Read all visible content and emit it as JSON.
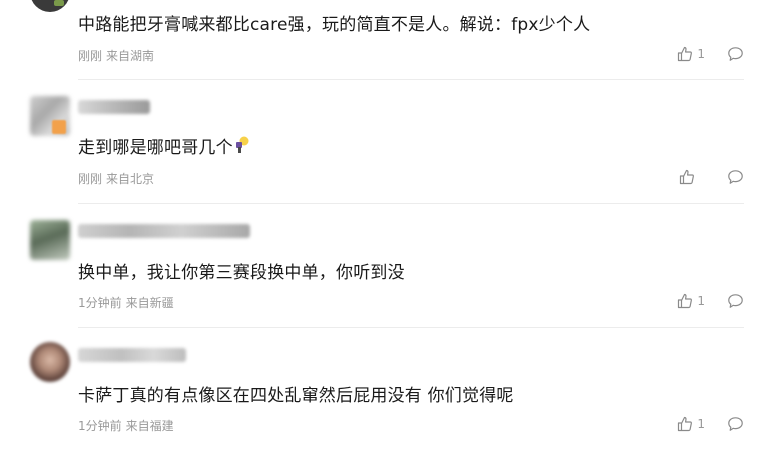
{
  "comments": [
    {
      "text": "中路能把牙膏喊来都比care强，玩的简直不是人。解说：fpx少个人",
      "time": "刚刚",
      "location": "来自湖南",
      "likes": "1"
    },
    {
      "text": "走到哪是哪吧哥几个",
      "time": "刚刚",
      "location": "来自北京",
      "likes": ""
    },
    {
      "text": "换中单，我让你第三赛段换中单，你听到没",
      "time": "1分钟前",
      "location": "来自新疆",
      "likes": "1"
    },
    {
      "text": "卡萨丁真的有点像区在四处乱窜然后屁用没有 你们觉得呢",
      "time": "1分钟前",
      "location": "来自福建",
      "likes": "1"
    }
  ],
  "icons": {
    "like": "thumbs-up-icon",
    "reply": "speech-bubble-icon",
    "emoji": "lightbulb-emoji-icon"
  },
  "colors": {
    "text": "#1a1a1a",
    "meta": "#999999",
    "divider": "#ececec"
  }
}
